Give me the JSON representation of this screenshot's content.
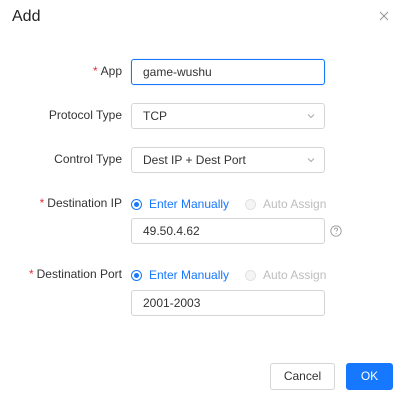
{
  "dialog": {
    "title": "Add"
  },
  "form": {
    "app": {
      "label": "App",
      "value": "game-wushu"
    },
    "protocol_type": {
      "label": "Protocol Type",
      "value": "TCP"
    },
    "control_type": {
      "label": "Control Type",
      "value": "Dest IP + Dest Port"
    },
    "destination_ip": {
      "label": "Destination IP",
      "option_manual": "Enter Manually",
      "option_auto": "Auto Assign",
      "value": "49.50.4.62"
    },
    "destination_port": {
      "label": "Destination Port",
      "option_manual": "Enter Manually",
      "option_auto": "Auto Assign",
      "value": "2001-2003"
    },
    "required_mark": "*"
  },
  "footer": {
    "cancel_label": "Cancel",
    "ok_label": "OK"
  },
  "colors": {
    "accent": "#1677ff",
    "required": "#e0323c",
    "disabled_text": "#bdbdbd"
  }
}
